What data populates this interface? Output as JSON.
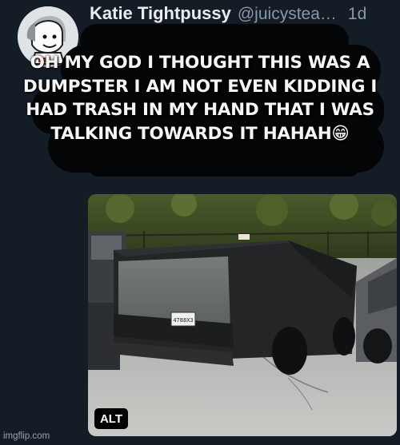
{
  "tweet": {
    "display_name": "Katie Tightpussy",
    "handle": "@juicystea…",
    "timestamp": "1d"
  },
  "caption": "OH MY GOD I THOUGHT THIS WAS A DUMPSTER I AM NOT EVEN KIDDING I HAD TRASH IN MY HAND THAT I WAS TALKING TOWARDS IT HAHAH😁",
  "media": {
    "alt_label": "ALT",
    "plate_text": "4788X3"
  },
  "watermark": "imgflip.com",
  "colors": {
    "background": "#141d26",
    "name": "#e8ecef",
    "muted": "#8899a6",
    "scribble": "#040507"
  }
}
